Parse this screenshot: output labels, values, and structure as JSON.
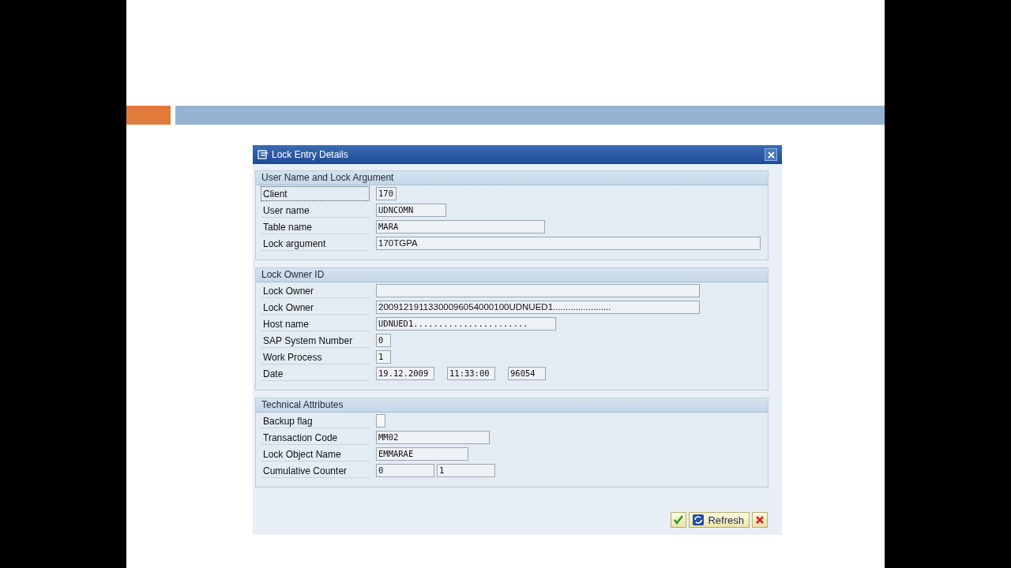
{
  "dialog": {
    "title": "Lock Entry Details",
    "sections": [
      {
        "title": "User Name and Lock Argument",
        "rows": [
          {
            "label": "Client",
            "focused": true,
            "fields": [
              {
                "kind": "input",
                "value": "170"
              }
            ]
          },
          {
            "label": "User name",
            "focused": false,
            "fields": [
              {
                "kind": "input",
                "value": "UDNCOMN"
              }
            ]
          },
          {
            "label": "Table name",
            "focused": false,
            "fields": [
              {
                "kind": "input",
                "value": "MARA"
              }
            ]
          },
          {
            "label": "Lock argument",
            "focused": false,
            "fields": [
              {
                "kind": "input",
                "value": "170TGPA"
              }
            ]
          }
        ]
      },
      {
        "title": "Lock Owner ID",
        "rows": [
          {
            "label": "Lock Owner",
            "focused": false,
            "fields": [
              {
                "kind": "input"
              }
            ]
          },
          {
            "label": "Lock Owner",
            "focused": false,
            "fields": [
              {
                "kind": "input",
                "value": "20091219113300096054000100UDNUED1......................."
              }
            ]
          },
          {
            "label": "Host name",
            "focused": false,
            "fields": [
              {
                "kind": "input",
                "value": "UDNUED1......................."
              }
            ]
          },
          {
            "label": "SAP System Number",
            "focused": false,
            "fields": [
              {
                "kind": "input",
                "value": "0"
              }
            ]
          },
          {
            "label": "Work Process",
            "focused": false,
            "fields": [
              {
                "kind": "input",
                "value": "1"
              }
            ]
          },
          {
            "label": "Date",
            "focused": false,
            "fields": [
              {
                "kind": "input",
                "value": "19.12.2009"
              },
              {
                "kind": "input",
                "value": "11:33:00"
              },
              {
                "kind": "input",
                "value": "96054"
              }
            ]
          }
        ]
      },
      {
        "title": "Technical Attributes",
        "rows": [
          {
            "label": "Backup flag",
            "focused": false,
            "fields": [
              {
                "kind": "checkbox",
                "checked": false
              }
            ]
          },
          {
            "label": "Transaction Code",
            "focused": false,
            "fields": [
              {
                "kind": "input",
                "value": "MM02"
              }
            ]
          },
          {
            "label": "Lock Object Name",
            "focused": false,
            "fields": [
              {
                "kind": "input",
                "value": "EMMARAE"
              }
            ]
          },
          {
            "label": "Cumulative Counter",
            "focused": false,
            "fields": [
              {
                "kind": "input",
                "value": "0"
              },
              {
                "kind": "input",
                "value": "1"
              }
            ]
          }
        ]
      }
    ],
    "buttons": [
      {
        "kind": "confirm"
      },
      {
        "kind": "refresh",
        "label": "Refresh"
      },
      {
        "kind": "cancel"
      }
    ]
  }
}
